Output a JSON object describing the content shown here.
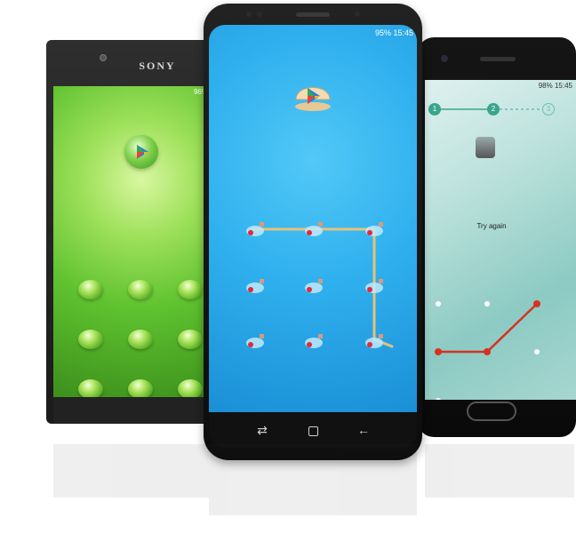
{
  "left_phone": {
    "brand": "SONY",
    "status_text": "96%"
  },
  "center_phone": {
    "status_text": "95% 15:45",
    "nav": {
      "recent_icon": "recent-apps-icon",
      "home_icon": "home-icon",
      "back_icon": "back-icon"
    },
    "pattern_nodes": 9
  },
  "right_phone": {
    "status_text": "98% 15:45",
    "steps": [
      "1",
      "2",
      "3"
    ],
    "message": "Try again"
  },
  "colors": {
    "center_screen": "#2fb0ee",
    "left_screen": "#5fc22f",
    "right_screen": "#b9e0da",
    "pattern_line_right": "#d6321e"
  }
}
